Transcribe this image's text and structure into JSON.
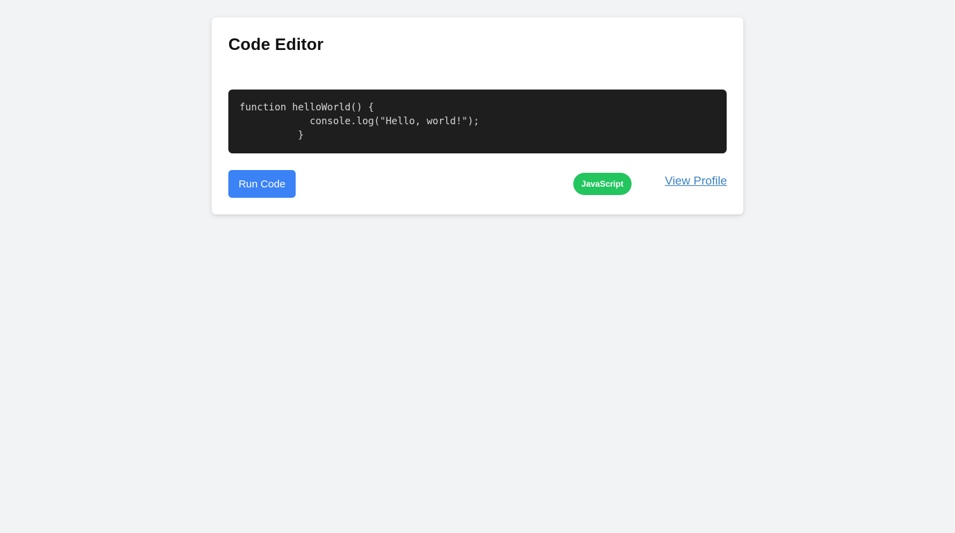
{
  "editor": {
    "title": "Code Editor",
    "code": "function helloWorld() {\n            console.log(\"Hello, world!\");\n          }",
    "run_label": "Run Code",
    "language_badge": "JavaScript",
    "profile_link": "View Profile"
  },
  "colors": {
    "page_background": "#f2f3f5",
    "code_background": "#1e1e1e",
    "run_button": "#3b82f6",
    "badge": "#22c55e",
    "link": "#3b82c4"
  }
}
